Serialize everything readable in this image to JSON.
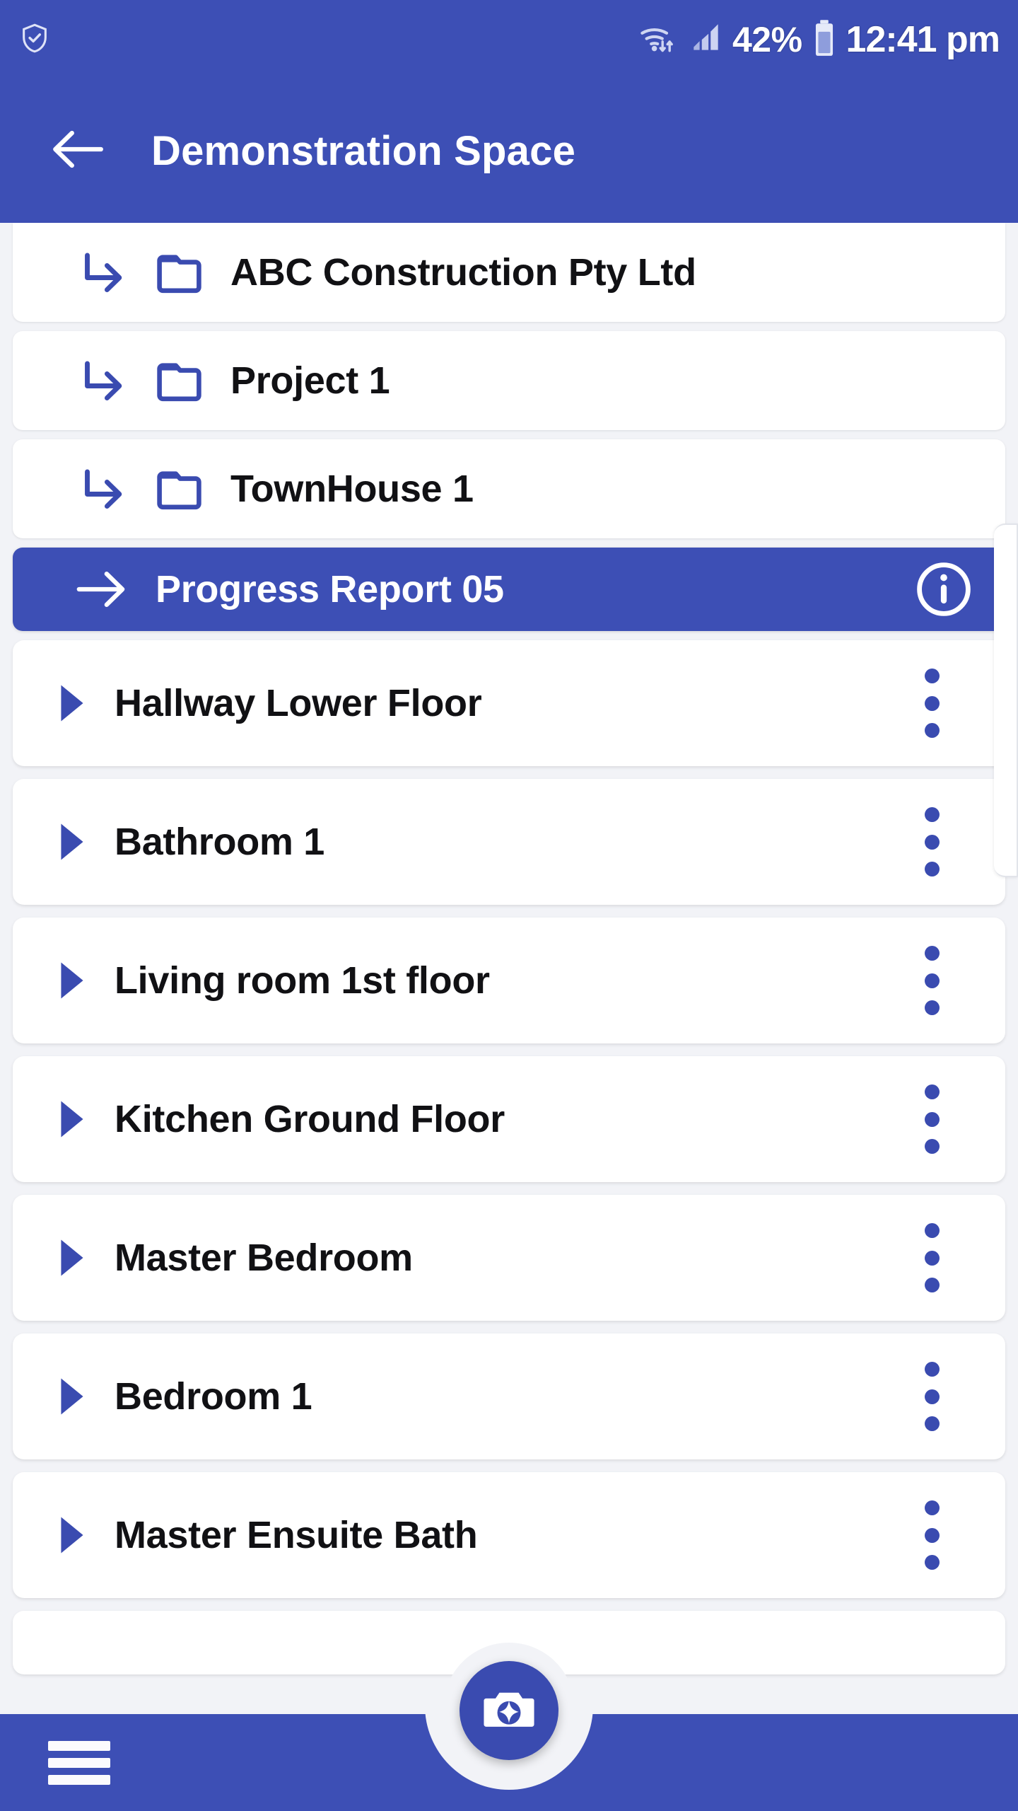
{
  "status_bar": {
    "shield_icon": "shield-check-icon",
    "wifi_icon": "wifi-icon",
    "signal_icon": "cellular-signal-icon",
    "battery_percent": "42%",
    "battery_icon": "battery-icon",
    "clock": "12:41 pm"
  },
  "app_bar": {
    "back_icon": "back-arrow-icon",
    "title": "Demonstration Space"
  },
  "breadcrumbs": [
    {
      "label": "ABC Construction Pty Ltd",
      "arrow_icon": "subdirectory-arrow-icon",
      "folder_icon": "folder-icon"
    },
    {
      "label": "Project 1",
      "arrow_icon": "subdirectory-arrow-icon",
      "folder_icon": "folder-icon"
    },
    {
      "label": "TownHouse 1",
      "arrow_icon": "subdirectory-arrow-icon",
      "folder_icon": "folder-icon"
    }
  ],
  "selected_report": {
    "label": "Progress Report 05",
    "arrow_icon": "right-arrow-icon",
    "info_icon": "info-circle-icon"
  },
  "rooms": [
    {
      "label": "Hallway Lower Floor",
      "expander_icon": "triangle-right-icon",
      "menu_icon": "more-vertical-icon"
    },
    {
      "label": "Bathroom 1",
      "expander_icon": "triangle-right-icon",
      "menu_icon": "more-vertical-icon"
    },
    {
      "label": "Living room 1st floor",
      "expander_icon": "triangle-right-icon",
      "menu_icon": "more-vertical-icon"
    },
    {
      "label": "Kitchen Ground Floor",
      "expander_icon": "triangle-right-icon",
      "menu_icon": "more-vertical-icon"
    },
    {
      "label": "Master Bedroom",
      "expander_icon": "triangle-right-icon",
      "menu_icon": "more-vertical-icon"
    },
    {
      "label": "Bedroom 1",
      "expander_icon": "triangle-right-icon",
      "menu_icon": "more-vertical-icon"
    },
    {
      "label": "Master Ensuite Bath",
      "expander_icon": "triangle-right-icon",
      "menu_icon": "more-vertical-icon"
    }
  ],
  "bottom_nav": {
    "menu_icon": "hamburger-menu-icon",
    "camera_icon": "camera-icon"
  },
  "colors": {
    "brand_blue": "#3d4fb5",
    "accent_blue": "#3a4bb0",
    "page_bg": "#f2f3f7",
    "card_bg": "#ffffff",
    "text_dark": "#111114",
    "text_light": "#ffffff"
  }
}
